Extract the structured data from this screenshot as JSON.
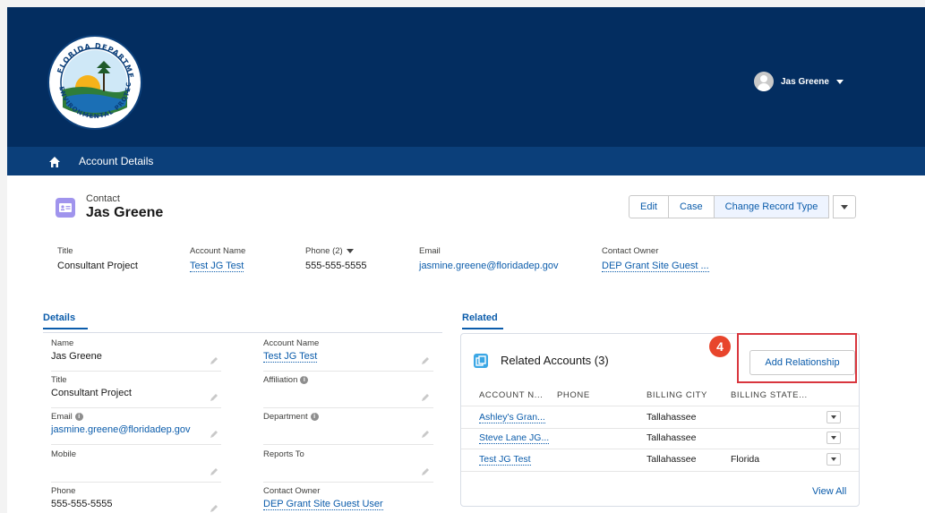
{
  "header": {
    "user_name": "Jas Greene"
  },
  "nav": {
    "label": "Account Details"
  },
  "record": {
    "type_label": "Contact",
    "name": "Jas Greene",
    "actions": [
      "Edit",
      "Case",
      "Change Record Type"
    ]
  },
  "highlights": {
    "title_label": "Title",
    "title_value": "Consultant Project",
    "account_label": "Account Name",
    "account_value": "Test JG Test",
    "phone_label": "Phone (2)",
    "phone_value": "555-555-5555",
    "email_label": "Email",
    "email_value": "jasmine.greene@floridadep.gov",
    "owner_label": "Contact Owner",
    "owner_value": "DEP Grant Site Guest ..."
  },
  "tabs": {
    "details": "Details",
    "related": "Related"
  },
  "details": {
    "name_label": "Name",
    "name_value": "Jas Greene",
    "title_label": "Title",
    "title_value": "Consultant Project",
    "email_label": "Email",
    "email_value": "jasmine.greene@floridadep.gov",
    "mobile_label": "Mobile",
    "phone_label": "Phone",
    "phone_value": "555-555-5555",
    "account_label": "Account Name",
    "account_value": "Test JG Test",
    "affiliation_label": "Affiliation",
    "department_label": "Department",
    "reports_label": "Reports To",
    "owner_label": "Contact Owner",
    "owner_value": "DEP Grant Site Guest User"
  },
  "related": {
    "card_title": "Related Accounts (3)",
    "add_button": "Add Relationship",
    "step_number": "4",
    "columns": [
      "ACCOUNT N...",
      "PHONE",
      "BILLING CITY",
      "BILLING STATE..."
    ],
    "rows": [
      {
        "account": "Ashley's Gran...",
        "phone": "",
        "city": "Tallahassee",
        "state": ""
      },
      {
        "account": "Steve Lane JG...",
        "phone": "",
        "city": "Tallahassee",
        "state": ""
      },
      {
        "account": "Test JG Test",
        "phone": "",
        "city": "Tallahassee",
        "state": "Florida"
      }
    ],
    "view_all": "View All"
  },
  "colors": {
    "topbar": "#032d60",
    "navbar": "#0b3f7a",
    "link": "#0b5cab",
    "highlight": "#d9363e"
  }
}
